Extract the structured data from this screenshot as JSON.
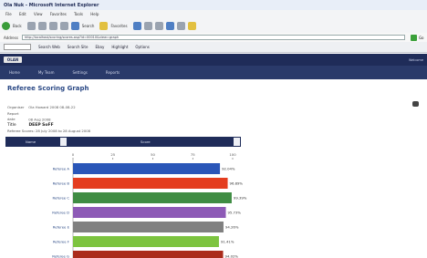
{
  "browser": {
    "title": "Ola Nuk - Microsoft Internet Explorer",
    "menu": [
      "File",
      "Edit",
      "View",
      "Favorites",
      "Tools",
      "Help"
    ],
    "toolbar": {
      "back_label": "Back",
      "search_label": "Search",
      "favorites_label": "Favorites"
    },
    "address_label": "Address",
    "address_value": "http://localhost/scoring/scores.asp?id=00010&view=graph",
    "go_label": "Go",
    "links": [
      "Search Web",
      "Search Site",
      "Ebay",
      "Highlight",
      "Options"
    ]
  },
  "app": {
    "logo": "OLAN",
    "right_text": "Welcome",
    "nav": [
      "Home",
      "My Team",
      "Settings",
      "Reports"
    ]
  },
  "page": {
    "title": "Referee Scoring Graph",
    "meta": [
      {
        "label": "Organiser",
        "value": "Ola Howard 2008 08-08-22"
      },
      {
        "label": "Report date",
        "value": "08 Aug 2008"
      }
    ],
    "main": {
      "label": "Title",
      "value": "DEEP SoFF"
    },
    "footnote": "Referee Scores: 28 July 2008 to 28 August 2008",
    "table_header": {
      "left": "Name",
      "right": "Score"
    }
  },
  "chart_data": {
    "type": "bar",
    "orientation": "horizontal",
    "categories": [
      "Referee A",
      "Referee B",
      "Referee C",
      "Referee D",
      "Referee E",
      "Referee F",
      "Referee G"
    ],
    "values": [
      92.04,
      96.89,
      99.39,
      95.73,
      94.26,
      91.41,
      94.02
    ],
    "value_labels": [
      "92.04%",
      "96.89%",
      "99.39%",
      "95.73%",
      "94.26%",
      "91.41%",
      "94.02%"
    ],
    "colors": [
      "#2a56b8",
      "#e43d1f",
      "#3f8c43",
      "#8d5ab6",
      "#808080",
      "#7dc440",
      "#ab2c1c"
    ],
    "xlim": [
      0,
      100
    ],
    "xticks": [
      0,
      25,
      50,
      75,
      100
    ]
  }
}
